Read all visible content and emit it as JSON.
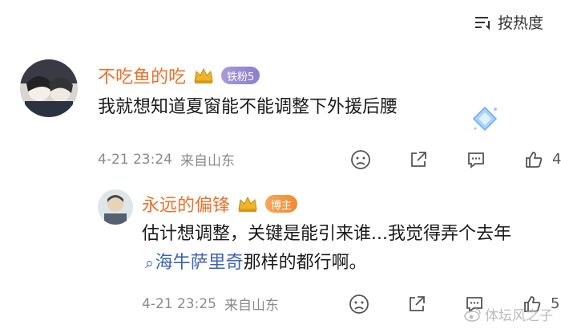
{
  "sort": {
    "label": "按热度",
    "icon": "sort-lines-icon"
  },
  "comments": [
    {
      "username": "不吃鱼的吃",
      "badge": "铁粉5",
      "text": "我就想知道夏窗能不能调整下外援后腰",
      "timestamp": "4-21 23:24",
      "source": "来自山东",
      "likes": "4"
    },
    {
      "username": "永远的偏锋",
      "badge": "博主",
      "text_before": "估计想调整，关键是能引来谁...我觉得弄个去年",
      "topic": "海牛萨里奇",
      "text_after": "那样的都行啊。",
      "timestamp": "4-21 23:25",
      "source": "来自山东",
      "likes": "5"
    }
  ],
  "watermark": {
    "text": "体坛风之子"
  },
  "colors": {
    "username": "#e8712b",
    "link": "#3b63b5",
    "meta": "#8a8a8a"
  }
}
